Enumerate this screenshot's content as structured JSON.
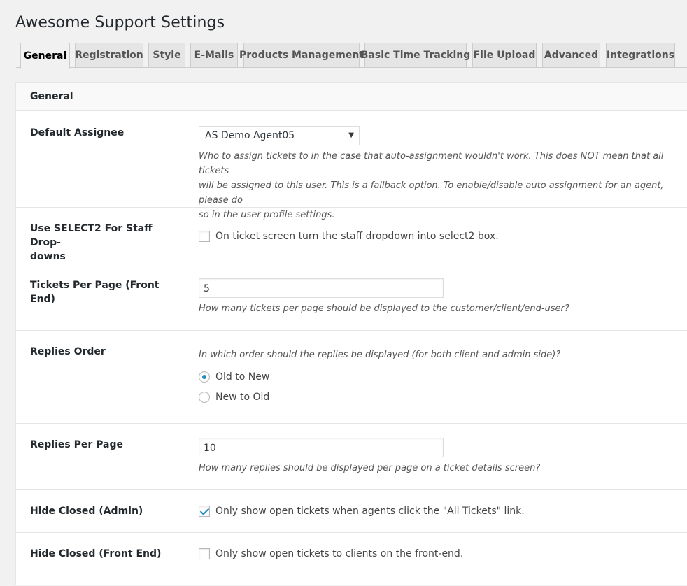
{
  "page": {
    "title": "Awesome Support Settings"
  },
  "tabs": [
    {
      "label": "General",
      "active": true
    },
    {
      "label": "Registration"
    },
    {
      "label": "Style"
    },
    {
      "label": "E-Mails"
    },
    {
      "label": "Products Management"
    },
    {
      "label": "Basic Time Tracking"
    },
    {
      "label": "File Upload"
    },
    {
      "label": "Advanced"
    },
    {
      "label": "Integrations"
    }
  ],
  "section": {
    "title": "General"
  },
  "default_assignee": {
    "label": "Default Assignee",
    "value": "AS Demo Agent05",
    "icon": "dropdown-arrow",
    "description_lines": [
      "Who to assign tickets to in the case that auto-assignment wouldn't work. This does NOT mean that all tickets",
      "will be assigned to this user. This is a fallback option. To enable/disable auto assignment for an agent, please do",
      "so in the user profile settings."
    ]
  },
  "select2": {
    "label_lines": [
      "Use SELECT2 For Staff Drop-",
      "downs"
    ],
    "checked": false,
    "text": "On ticket screen turn the staff dropdown into select2 box."
  },
  "tickets_per_page": {
    "label": "Tickets Per Page (Front End)",
    "value": "5",
    "description": "How many tickets per page should be displayed to the customer/client/end-user?"
  },
  "replies_order": {
    "label": "Replies Order",
    "description": "In which order should the replies be displayed (for both client and admin side)?",
    "options": [
      {
        "label": "Old to New",
        "selected": true
      },
      {
        "label": "New to Old",
        "selected": false
      }
    ]
  },
  "replies_per_page": {
    "label": "Replies Per Page",
    "value": "10",
    "description": "How many replies should be displayed per page on a ticket details screen?"
  },
  "hide_closed_admin": {
    "label": "Hide Closed (Admin)",
    "checked": true,
    "text": "Only show open tickets when agents click the \"All Tickets\" link."
  },
  "hide_closed_front": {
    "label": "Hide Closed (Front End)",
    "checked": false,
    "text": "Only show open tickets to clients on the front-end."
  },
  "colors": {
    "accent": "#1e8cbe",
    "background": "#f1f1f1",
    "border": "#e5e5e5"
  }
}
